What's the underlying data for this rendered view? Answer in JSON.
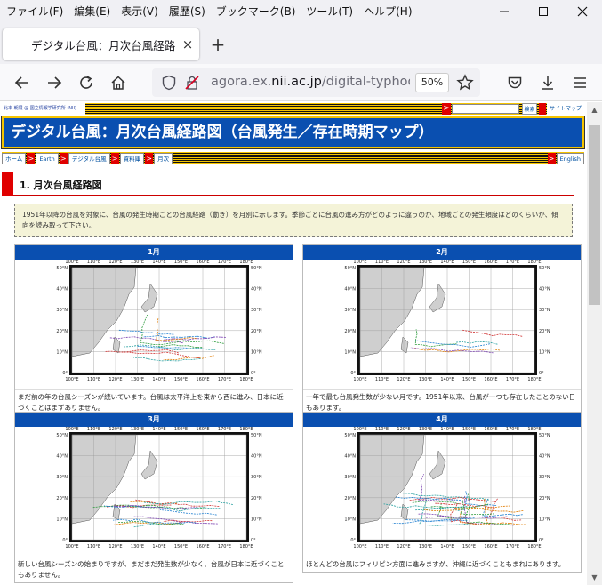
{
  "menu": [
    "ファイル(F)",
    "編集(E)",
    "表示(V)",
    "履歴(S)",
    "ブックマーク(B)",
    "ツール(T)",
    "ヘルプ(H)"
  ],
  "tab": {
    "title": "デジタル台風：月次台風経路図",
    "close": "×",
    "new": "+"
  },
  "address": {
    "host_pre": "agora.ex.",
    "host": "nii.ac.jp",
    "path": "/digital-typhoon/ref",
    "zoom": "50%"
  },
  "site": {
    "org": "北本 朝展 @ 国立情報学研究所 (NII)",
    "arrow": ">",
    "search_button": "検索",
    "sitemap": "サイトマップ",
    "banner": "デジタル台風：月次台風経路図（台風発生／存在時期マップ）",
    "breadcrumbs": [
      "ホーム",
      "Earth",
      "デジタル台風",
      "資料庫",
      "月次"
    ],
    "english": "English"
  },
  "section": {
    "title": "1. 月次台風経路図",
    "intro": "1951年以降の台風を対象に、台風の発生時期ごとの台風経路（動き）を月別に示します。季節ごとに台風の進み方がどのように違うのか、地域ごとの発生頻度はどのくらいか、傾向を読み取って下さい。"
  },
  "map_axes": {
    "lon_labels": [
      "100°E",
      "110°E",
      "120°E",
      "130°E",
      "140°E",
      "150°E",
      "160°E",
      "170°E",
      "180°E"
    ],
    "lat_labels": [
      "50°N",
      "40°N",
      "30°N",
      "20°N",
      "10°N",
      "0°"
    ]
  },
  "months": [
    {
      "label": "1月",
      "caption": "まだ前の年の台風シーズンが続いています。台風は太平洋上を東から西に進み、日本に近づくことはまずありません。"
    },
    {
      "label": "2月",
      "caption": "一年で最も台風発生数が少ない月です。1951年以来、台風が一つも存在したことのない日もあります。"
    },
    {
      "label": "3月",
      "caption": "新しい台風シーズンの始まりですが、まだまだ発生数が少なく、台風が日本に近づくこともありません。"
    },
    {
      "label": "4月",
      "caption": "ほとんどの台風はフィリピン方面に進みますが、沖縄に近づくこともまれにあります。"
    }
  ],
  "colors": {
    "banner": "#0a4fb0",
    "accent_red": "#e00000",
    "stripe_yellow": "#f5c400"
  }
}
